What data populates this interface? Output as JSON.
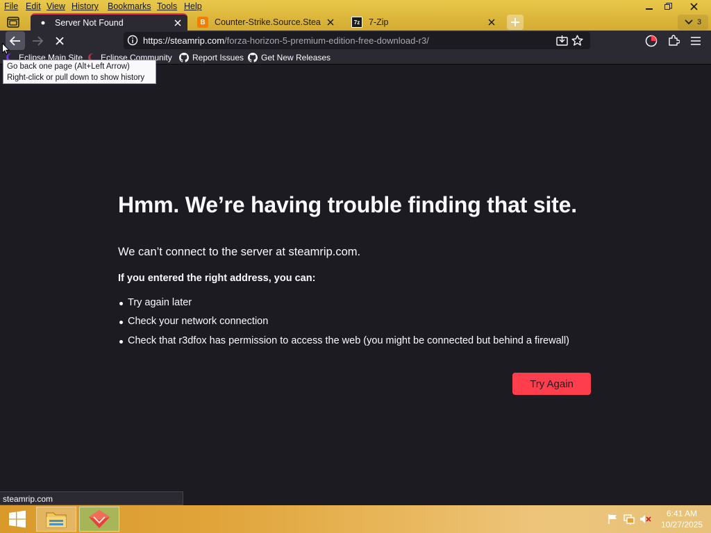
{
  "menubar": {
    "items": [
      "File",
      "Edit",
      "View",
      "History",
      "Bookmarks",
      "Tools",
      "Help"
    ]
  },
  "window_controls": {
    "minimize_icon": "minimize-icon",
    "restore_icon": "restore-icon",
    "close_icon": "close-icon"
  },
  "tabs": [
    {
      "title": "Server Not Found",
      "active": true,
      "icon": "page-icon"
    },
    {
      "title": "Counter-Strike.Source.SteamRIP",
      "active": false,
      "icon": "blogger-icon",
      "icon_text": "B",
      "icon_color": "#f57d00"
    },
    {
      "title": "7-Zip",
      "active": false,
      "icon": "7zip-icon",
      "icon_text": "7z"
    }
  ],
  "tab_count": "3",
  "urlbar": {
    "host": "https://steamrip.com",
    "path": "/forza-horizon-5-premium-edition-free-download-r3/"
  },
  "bookmarks": [
    {
      "label": "Eclipse Main Site",
      "icon": "eclipse-icon"
    },
    {
      "label": "Eclipse Community",
      "icon": "eclipse-icon"
    },
    {
      "label": "Report Issues",
      "icon": "github-icon"
    },
    {
      "label": "Get New Releases",
      "icon": "github-icon"
    }
  ],
  "tooltip": {
    "line1": "Go back one page (Alt+Left Arrow)",
    "line2": "Right-click or pull down to show history"
  },
  "error": {
    "title": "Hmm. We’re having trouble finding that site.",
    "short_desc": "We can’t connect to the server at steamrip.com.",
    "hint": "If you entered the right address, you can:",
    "suggestions": [
      "Try again later",
      "Check your network connection",
      "Check that r3dfox has permission to access the web (you might be connected but behind a firewall)"
    ],
    "button_label": "Try Again"
  },
  "status": "steamrip.com",
  "clock": {
    "time": "6:41 AM",
    "date": "10/27/2025"
  },
  "colors": {
    "accent": "#ff3e4d",
    "active_tab_border": "#e5366b",
    "page_background": "#1c1b22",
    "toolbar": "#2b2a33",
    "theme_yellow": "#e8c84a"
  }
}
